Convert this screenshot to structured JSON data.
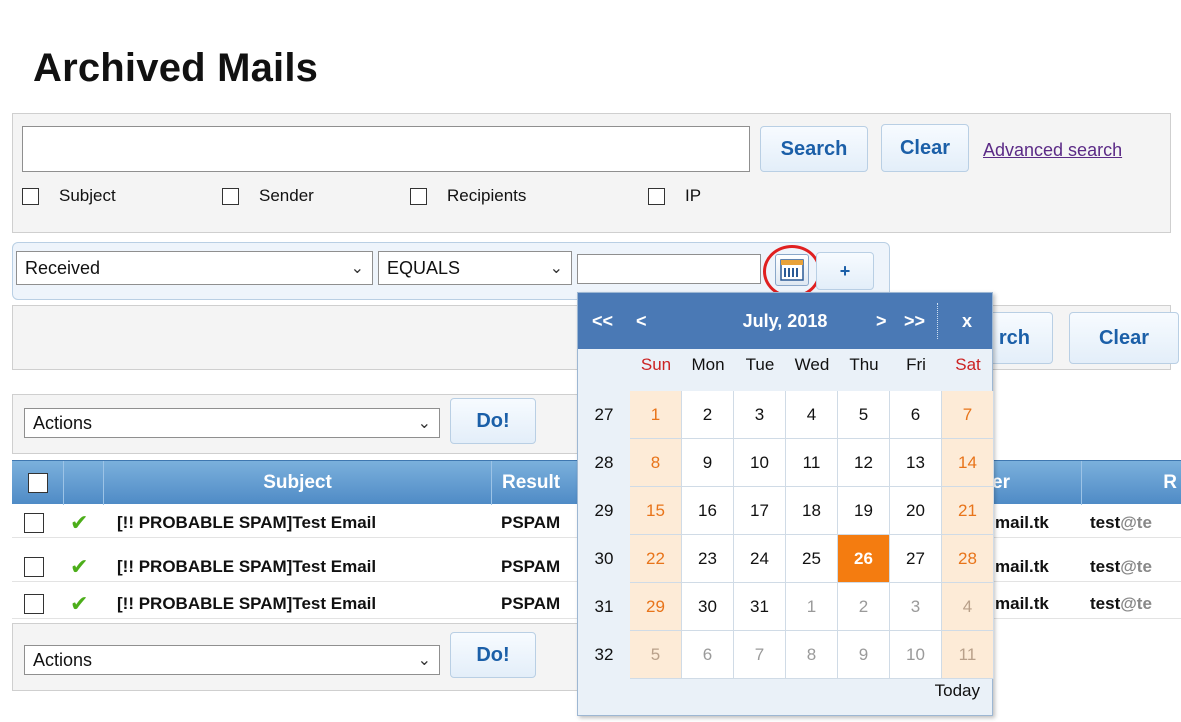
{
  "page": {
    "title": "Archived Mails"
  },
  "search": {
    "query_value": "",
    "search_label": "Search",
    "clear_label": "Clear",
    "advanced_label": "Advanced search",
    "checkboxes": [
      {
        "label": "Subject",
        "checked": false
      },
      {
        "label": "Sender",
        "checked": false
      },
      {
        "label": "Recipients",
        "checked": false
      },
      {
        "label": "IP",
        "checked": false
      }
    ]
  },
  "filter": {
    "field_value": "Received",
    "operator_value": "EQUALS",
    "date_value": "",
    "add_label": "+"
  },
  "action_panel": {
    "search_label": "rch",
    "clear_label": "Clear"
  },
  "actions": {
    "select_value": "Actions",
    "do_label": "Do!"
  },
  "grid": {
    "columns": [
      "Subject",
      "Result",
      "Sender",
      "R"
    ],
    "rows": [
      {
        "subject": "[!! PROBABLE SPAM]Test Email",
        "result": "PSPAM",
        "sender": "mail.tk",
        "recipient_bold": "test",
        "recipient_rest": "@te"
      },
      {
        "subject": "[!! PROBABLE SPAM]Test Email",
        "result": "PSPAM",
        "sender": "mail.tk",
        "recipient_bold": "test",
        "recipient_rest": "@te"
      },
      {
        "subject": "[!! PROBABLE SPAM]Test Email",
        "result": "PSPAM",
        "sender": "mail.tk",
        "recipient_bold": "test",
        "recipient_rest": "@te"
      }
    ]
  },
  "calendar": {
    "month_label": "July, 2018",
    "prev_year": "<<",
    "prev_month": "<",
    "next_month": ">",
    "next_year": ">>",
    "close": "x",
    "today_label": "Today",
    "days_of_week": [
      "Sun",
      "Mon",
      "Tue",
      "Wed",
      "Thu",
      "Fri",
      "Sat"
    ],
    "weeks": [
      {
        "week": "27",
        "days": [
          "1",
          "2",
          "3",
          "4",
          "5",
          "6",
          "7"
        ]
      },
      {
        "week": "28",
        "days": [
          "8",
          "9",
          "10",
          "11",
          "12",
          "13",
          "14"
        ]
      },
      {
        "week": "29",
        "days": [
          "15",
          "16",
          "17",
          "18",
          "19",
          "20",
          "21"
        ]
      },
      {
        "week": "30",
        "days": [
          "22",
          "23",
          "24",
          "25",
          "26",
          "27",
          "28"
        ]
      },
      {
        "week": "31",
        "days": [
          "29",
          "30",
          "31",
          "1",
          "2",
          "3",
          "4"
        ]
      },
      {
        "week": "32",
        "days": [
          "5",
          "6",
          "7",
          "8",
          "9",
          "10",
          "11"
        ]
      }
    ],
    "selected_day": "26",
    "colors": {
      "weekend_text": "#e8741a",
      "weekend_bg": "#fdebd7",
      "selected_bg": "#f47c10",
      "header_bg": "#4a79b5",
      "weekend_header": "#cc2222"
    }
  }
}
